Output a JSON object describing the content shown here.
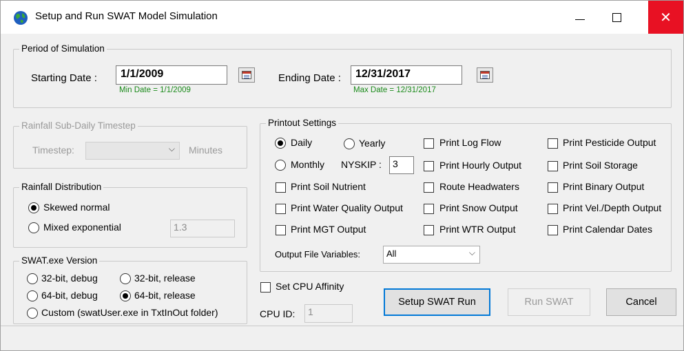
{
  "window": {
    "title": "Setup and Run SWAT Model Simulation",
    "minimize_label": "—",
    "close_label": "✕"
  },
  "period": {
    "legend": "Period of Simulation",
    "start_label": "Starting Date :",
    "start_value": "1/1/2009",
    "start_hint": "Min Date = 1/1/2009",
    "end_label": "Ending Date :",
    "end_value": "12/31/2017",
    "end_hint": "Max Date = 12/31/2017"
  },
  "rainfall_timestep": {
    "legend": "Rainfall Sub-Daily Timestep",
    "timestep_label": "Timestep:",
    "timestep_value": "",
    "minutes_label": "Minutes"
  },
  "rainfall_distribution": {
    "legend": "Rainfall Distribution",
    "skewed_label": "Skewed normal",
    "mixed_label": "Mixed exponential",
    "exponent_value": "1.3"
  },
  "swat_version": {
    "legend": "SWAT.exe Version",
    "opt_32_debug": "32-bit, debug",
    "opt_32_release": "32-bit, release",
    "opt_64_debug": "64-bit, debug",
    "opt_64_release": "64-bit, release",
    "opt_custom": "Custom (swatUser.exe in TxtInOut folder)"
  },
  "printout": {
    "legend": "Printout Settings",
    "daily": "Daily",
    "yearly": "Yearly",
    "monthly": "Monthly",
    "nyskip_label": "NYSKIP :",
    "nyskip_value": "3",
    "soil_nutrient": "Print Soil Nutrient",
    "water_quality": "Print Water Quality Output",
    "mgt_output": "Print MGT Output",
    "log_flow": "Print Log Flow",
    "hourly_output": "Print Hourly Output",
    "route_headwaters": "Route Headwaters",
    "snow_output": "Print Snow Output",
    "wtr_output": "Print WTR Output",
    "pesticide_output": "Print Pesticide Output",
    "soil_storage": "Print Soil Storage",
    "binary_output": "Print Binary Output",
    "vel_depth_output": "Print Vel./Depth Output",
    "calendar_dates": "Print Calendar Dates",
    "output_vars_label": "Output File Variables:",
    "output_vars_value": "All"
  },
  "cpu": {
    "affinity_label": "Set CPU Affinity",
    "cpu_id_label": "CPU ID:",
    "cpu_id_value": "1"
  },
  "buttons": {
    "setup": "Setup SWAT Run",
    "run": "Run SWAT",
    "cancel": "Cancel"
  }
}
